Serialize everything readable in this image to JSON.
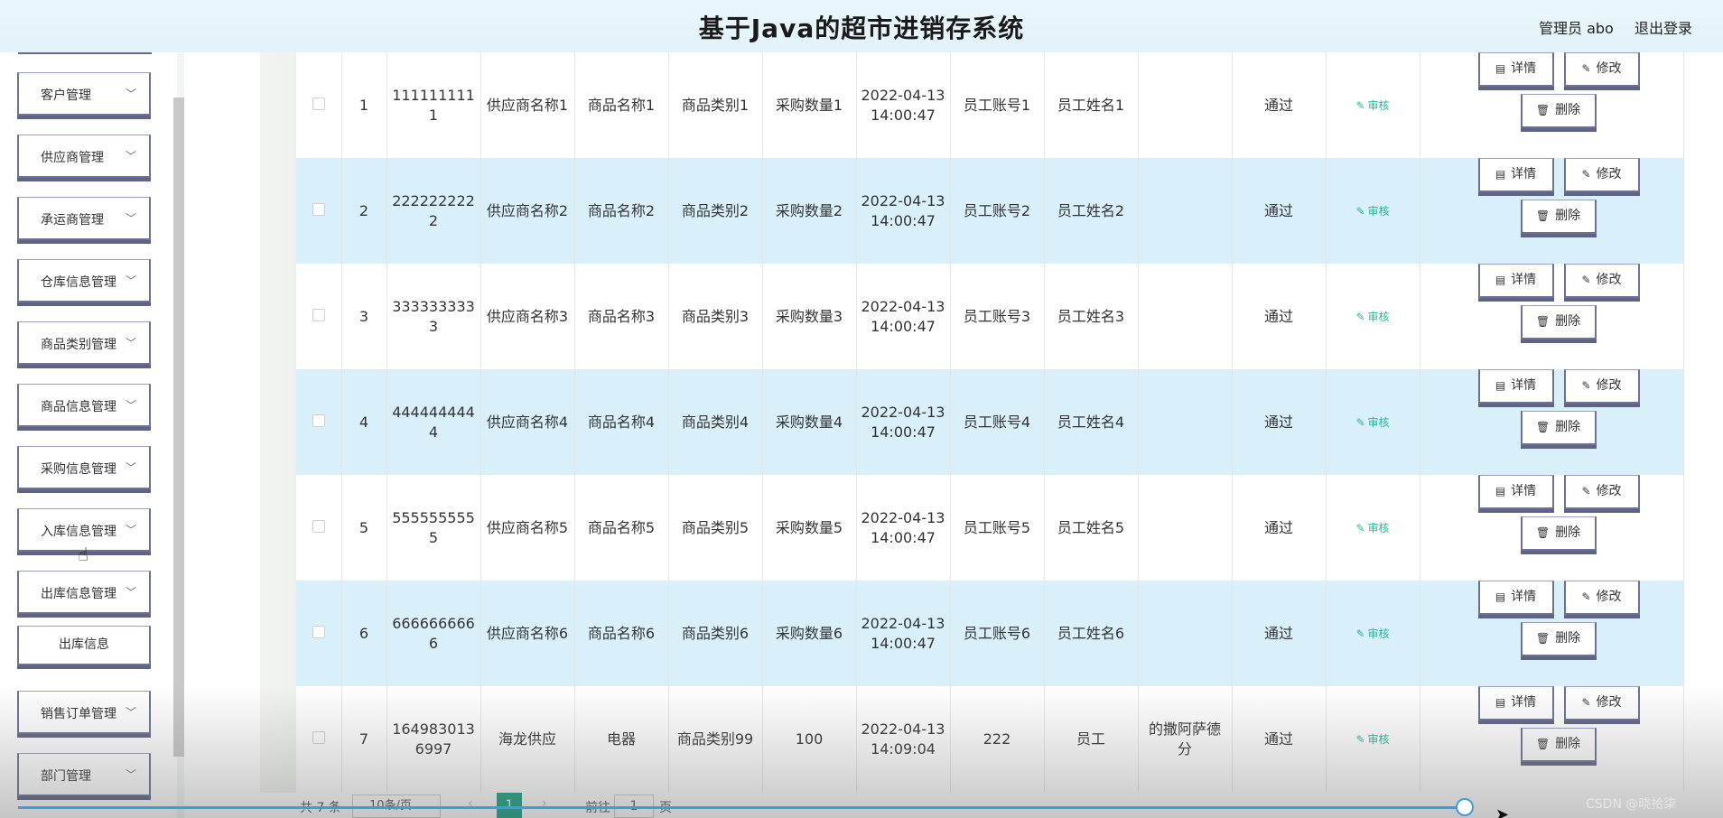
{
  "header": {
    "title": "基于Java的超市进销存系统",
    "admin": "管理员 abo",
    "logout": "退出登录"
  },
  "sidebar": {
    "items": [
      {
        "label": "客户管理"
      },
      {
        "label": "供应商管理"
      },
      {
        "label": "承运商管理"
      },
      {
        "label": "仓库信息管理"
      },
      {
        "label": "商品类别管理"
      },
      {
        "label": "商品信息管理"
      },
      {
        "label": "采购信息管理"
      },
      {
        "label": "入库信息管理"
      },
      {
        "label": "出库信息管理"
      },
      {
        "label": "销售订单管理"
      },
      {
        "label": "部门管理"
      }
    ],
    "sub_item": "出库信息"
  },
  "table": {
    "rows": [
      {
        "idx": "1",
        "code": "1111111111",
        "supplier": "供应商名称1",
        "product": "商品名称1",
        "category": "商品类别1",
        "qty": "采购数量1",
        "time": "2022-04-13 14:00:47",
        "account": "员工账号1",
        "name": "员工姓名1",
        "remark": "",
        "status": "通过"
      },
      {
        "idx": "2",
        "code": "2222222222",
        "supplier": "供应商名称2",
        "product": "商品名称2",
        "category": "商品类别2",
        "qty": "采购数量2",
        "time": "2022-04-13 14:00:47",
        "account": "员工账号2",
        "name": "员工姓名2",
        "remark": "",
        "status": "通过"
      },
      {
        "idx": "3",
        "code": "3333333333",
        "supplier": "供应商名称3",
        "product": "商品名称3",
        "category": "商品类别3",
        "qty": "采购数量3",
        "time": "2022-04-13 14:00:47",
        "account": "员工账号3",
        "name": "员工姓名3",
        "remark": "",
        "status": "通过"
      },
      {
        "idx": "4",
        "code": "4444444444",
        "supplier": "供应商名称4",
        "product": "商品名称4",
        "category": "商品类别4",
        "qty": "采购数量4",
        "time": "2022-04-13 14:00:47",
        "account": "员工账号4",
        "name": "员工姓名4",
        "remark": "",
        "status": "通过"
      },
      {
        "idx": "5",
        "code": "5555555555",
        "supplier": "供应商名称5",
        "product": "商品名称5",
        "category": "商品类别5",
        "qty": "采购数量5",
        "time": "2022-04-13 14:00:47",
        "account": "员工账号5",
        "name": "员工姓名5",
        "remark": "",
        "status": "通过"
      },
      {
        "idx": "6",
        "code": "6666666666",
        "supplier": "供应商名称6",
        "product": "商品名称6",
        "category": "商品类别6",
        "qty": "采购数量6",
        "time": "2022-04-13 14:00:47",
        "account": "员工账号6",
        "name": "员工姓名6",
        "remark": "",
        "status": "通过"
      },
      {
        "idx": "7",
        "code": "1649830136997",
        "supplier": "海龙供应",
        "product": "电器",
        "category": "商品类别99",
        "qty": "100",
        "time": "2022-04-13 14:09:04",
        "account": "222",
        "name": "员工",
        "remark": "的撒阿萨德分",
        "status": "通过"
      }
    ],
    "audit_label": "审核",
    "detail_label": "详情",
    "edit_label": "修改",
    "delete_label": "删除"
  },
  "pager": {
    "total": "共 7 条",
    "page_size": "10条/页",
    "current_page": "1",
    "goto_label": "前往",
    "goto_value": "1",
    "page_suffix": "页"
  },
  "watermark": "CSDN @晓拾柒"
}
